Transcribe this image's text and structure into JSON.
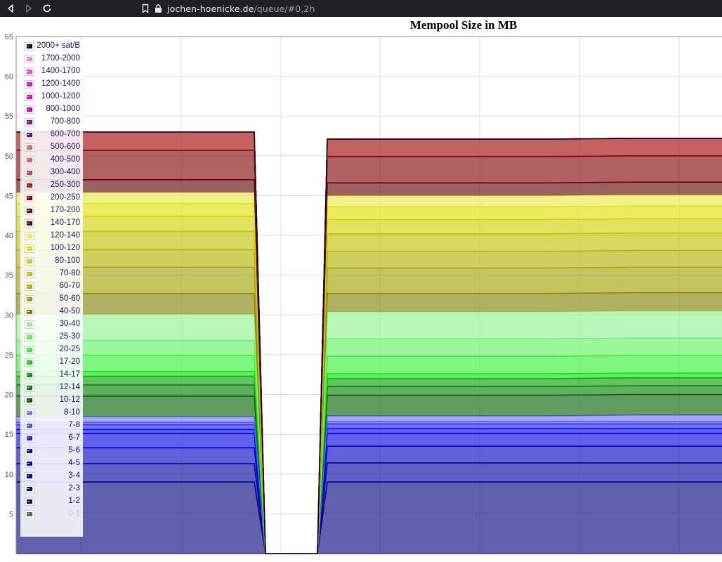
{
  "browser": {
    "url_host": "jochen-hoenicke.de",
    "url_path": "/queue/#0,2h"
  },
  "chart_data": {
    "type": "area",
    "title": "Mempool Size in MB",
    "xlabel": "",
    "ylabel": "",
    "ylim": [
      0,
      65
    ],
    "yticks": [
      5,
      10,
      15,
      20,
      25,
      30,
      35,
      40,
      45,
      50,
      55,
      60,
      65
    ],
    "stacked": true,
    "grid": true,
    "legend": "top-left",
    "x": [
      0,
      1,
      2,
      3,
      4,
      5,
      6,
      7,
      8,
      9,
      10,
      11,
      12
    ],
    "series": [
      {
        "name": "0-1",
        "color": "#606060",
        "values": [
          0,
          0,
          0,
          0,
          0,
          0,
          0,
          0,
          0,
          0,
          0,
          0,
          0
        ]
      },
      {
        "name": "1-2",
        "color": "#000080",
        "values": [
          9.0,
          9.0,
          9.0,
          0,
          0,
          0,
          0,
          9.0,
          9.0,
          9.0,
          9.0,
          9.0,
          9.0
        ]
      },
      {
        "name": "2-3",
        "color": "#0000a0",
        "values": [
          2.3,
          2.3,
          2.3,
          0,
          0,
          0,
          0,
          2.4,
          2.4,
          2.4,
          2.4,
          2.4,
          2.4
        ]
      },
      {
        "name": "3-4",
        "color": "#0000c0",
        "values": [
          2.0,
          2.0,
          2.0,
          0,
          0,
          0,
          0,
          2.1,
          2.1,
          2.1,
          2.1,
          2.1,
          2.1
        ]
      },
      {
        "name": "4-5",
        "color": "#0000e0",
        "values": [
          1.8,
          1.8,
          1.8,
          0,
          0,
          0,
          0,
          1.6,
          1.6,
          1.6,
          1.6,
          1.6,
          1.6
        ]
      },
      {
        "name": "5-6",
        "color": "#0000ff",
        "values": [
          0.5,
          0.5,
          0.5,
          0,
          0,
          0,
          0,
          0.6,
          0.6,
          0.6,
          0.6,
          0.6,
          0.6
        ]
      },
      {
        "name": "6-7",
        "color": "#2020ff",
        "values": [
          0.6,
          0.6,
          0.6,
          0,
          0,
          0,
          0,
          0.6,
          0.6,
          0.6,
          0.6,
          0.6,
          0.6
        ]
      },
      {
        "name": "7-8",
        "color": "#5050ff",
        "values": [
          0.3,
          0.3,
          0.3,
          0,
          0,
          0,
          0,
          0.3,
          0.3,
          0.3,
          0.3,
          0.3,
          0.3
        ]
      },
      {
        "name": "8-10",
        "color": "#7070ff",
        "values": [
          0.7,
          0.7,
          0.7,
          0,
          0,
          0,
          0,
          0.7,
          0.7,
          0.7,
          0.8,
          0.8,
          0.8
        ]
      },
      {
        "name": "10-12",
        "color": "#006000",
        "values": [
          2.6,
          2.6,
          2.6,
          0,
          0,
          0,
          0,
          2.6,
          2.6,
          2.6,
          2.6,
          2.6,
          2.6
        ]
      },
      {
        "name": "12-14",
        "color": "#008000",
        "values": [
          1.4,
          1.4,
          1.4,
          0,
          0,
          0,
          0,
          1.1,
          1.1,
          1.1,
          1.1,
          1.1,
          1.1
        ]
      },
      {
        "name": "14-17",
        "color": "#00a000",
        "values": [
          1.1,
          1.1,
          1.1,
          0,
          0,
          0,
          0,
          1.0,
          1.0,
          1.0,
          1.0,
          1.0,
          1.0
        ]
      },
      {
        "name": "17-20",
        "color": "#00e000",
        "values": [
          0.6,
          0.6,
          0.6,
          0,
          0,
          0,
          0,
          0.6,
          0.6,
          0.6,
          0.6,
          0.6,
          0.6
        ]
      },
      {
        "name": "20-25",
        "color": "#30f030",
        "values": [
          2.0,
          2.0,
          2.0,
          0,
          0,
          0,
          0,
          2.2,
          2.2,
          2.2,
          2.2,
          2.2,
          2.2
        ]
      },
      {
        "name": "25-30",
        "color": "#60f060",
        "values": [
          1.9,
          1.9,
          1.9,
          0,
          0,
          0,
          0,
          2.2,
          2.2,
          2.2,
          2.2,
          2.2,
          2.2
        ]
      },
      {
        "name": "30-40",
        "color": "#90f090",
        "values": [
          3.3,
          3.3,
          3.3,
          0,
          0,
          0,
          0,
          3.4,
          3.4,
          3.4,
          3.4,
          3.4,
          3.4
        ]
      },
      {
        "name": "40-50",
        "color": "#808000",
        "values": [
          2.6,
          2.6,
          2.6,
          0,
          0,
          0,
          0,
          2.3,
          2.3,
          2.3,
          2.3,
          2.3,
          2.3
        ]
      },
      {
        "name": "50-60",
        "color": "#a0a000",
        "values": [
          3.3,
          3.3,
          3.3,
          0,
          0,
          0,
          0,
          3.2,
          3.2,
          3.2,
          3.2,
          3.2,
          3.2
        ]
      },
      {
        "name": "60-70",
        "color": "#b0b000",
        "values": [
          2.2,
          2.2,
          2.2,
          0,
          0,
          0,
          0,
          2.1,
          2.1,
          2.1,
          2.1,
          2.1,
          2.1
        ]
      },
      {
        "name": "70-80",
        "color": "#c0c000",
        "values": [
          2.3,
          2.3,
          2.3,
          0,
          0,
          0,
          0,
          2.2,
          2.2,
          2.2,
          2.2,
          2.2,
          2.2
        ]
      },
      {
        "name": "80-100",
        "color": "#d0d000",
        "values": [
          1.9,
          1.9,
          1.9,
          0,
          0,
          0,
          0,
          1.8,
          1.8,
          1.8,
          1.8,
          1.8,
          1.8
        ]
      },
      {
        "name": "100-120",
        "color": "#e0e000",
        "values": [
          1.6,
          1.6,
          1.6,
          0,
          0,
          0,
          0,
          1.6,
          1.6,
          1.6,
          1.6,
          1.6,
          1.6
        ]
      },
      {
        "name": "120-140",
        "color": "#e8e840",
        "values": [
          1.4,
          1.4,
          1.4,
          0,
          0,
          0,
          0,
          1.4,
          1.4,
          1.4,
          1.4,
          1.4,
          1.4
        ]
      },
      {
        "name": "140-170",
        "color": "#600000",
        "values": [
          1.6,
          1.6,
          1.6,
          0,
          0,
          0,
          0,
          1.6,
          1.6,
          1.6,
          1.6,
          1.6,
          1.6
        ]
      },
      {
        "name": "170-200",
        "color": "#800000",
        "values": [
          3.7,
          3.7,
          3.7,
          0,
          0,
          0,
          0,
          3.3,
          3.3,
          3.3,
          3.3,
          3.3,
          3.3
        ]
      },
      {
        "name": "200-250",
        "color": "#a00000",
        "values": [
          2.3,
          2.3,
          2.3,
          0,
          0,
          0,
          0,
          2.2,
          2.2,
          2.2,
          2.2,
          2.2,
          2.2
        ]
      },
      {
        "name": "250-300",
        "color": "#e00000",
        "values": [
          0,
          0,
          0,
          0,
          0,
          0,
          0,
          0,
          0,
          0,
          0,
          0,
          0
        ]
      },
      {
        "name": "300-400",
        "color": "#f03030",
        "values": [
          0,
          0,
          0,
          0,
          0,
          0,
          0,
          0,
          0,
          0,
          0,
          0,
          0
        ]
      },
      {
        "name": "400-500",
        "color": "#f05050",
        "values": [
          0,
          0,
          0,
          0,
          0,
          0,
          0,
          0,
          0,
          0,
          0,
          0,
          0
        ]
      },
      {
        "name": "500-600",
        "color": "#e06060",
        "values": [
          0,
          0,
          0,
          0,
          0,
          0,
          0,
          0,
          0,
          0,
          0,
          0,
          0
        ]
      },
      {
        "name": "600-700",
        "color": "#800080",
        "values": [
          0,
          0,
          0,
          0,
          0,
          0,
          0,
          0,
          0,
          0,
          0,
          0,
          0
        ]
      },
      {
        "name": "700-800",
        "color": "#a000a0",
        "values": [
          0,
          0,
          0,
          0,
          0,
          0,
          0,
          0,
          0,
          0,
          0,
          0,
          0
        ]
      },
      {
        "name": "800-1000",
        "color": "#c000c0",
        "values": [
          0,
          0,
          0,
          0,
          0,
          0,
          0,
          0,
          0,
          0,
          0,
          0,
          0
        ]
      },
      {
        "name": "1000-1200",
        "color": "#e000e0",
        "values": [
          0,
          0,
          0,
          0,
          0,
          0,
          0,
          0,
          0,
          0,
          0,
          0,
          0
        ]
      },
      {
        "name": "1200-1400",
        "color": "#f000f0",
        "values": [
          0,
          0,
          0,
          0,
          0,
          0,
          0,
          0,
          0,
          0,
          0,
          0,
          0
        ]
      },
      {
        "name": "1400-1700",
        "color": "#f040f0",
        "values": [
          0,
          0,
          0,
          0,
          0,
          0,
          0,
          0,
          0,
          0,
          0,
          0,
          0
        ]
      },
      {
        "name": "1700-2000",
        "color": "#f080f0",
        "values": [
          0,
          0,
          0,
          0,
          0,
          0,
          0,
          0,
          0,
          0,
          0,
          0,
          0
        ]
      },
      {
        "name": "2000+ sat/B",
        "color": "#000000",
        "values": [
          0,
          0,
          0,
          0,
          0,
          0,
          0,
          0,
          0,
          0,
          0,
          0,
          0
        ]
      }
    ]
  }
}
